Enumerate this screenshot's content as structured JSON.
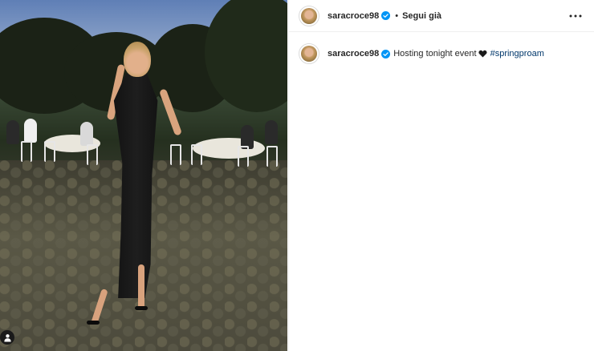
{
  "post": {
    "author": {
      "username": "saracroce98",
      "verified": true,
      "avatar_icon": "profile-photo"
    },
    "follow_label": "Segui già",
    "separator": "•",
    "more_icon": "more-horizontal-icon",
    "caption": {
      "username": "saracroce98",
      "text": "Hosting tonight event",
      "emoji_icon": "black-heart-icon",
      "hashtag": "#springproam"
    },
    "media": {
      "tagged_users_icon": "person-icon"
    }
  },
  "colors": {
    "text": "#262626",
    "hashtag": "#00376b",
    "verified_badge": "#0095f6",
    "border": "#efefef"
  }
}
